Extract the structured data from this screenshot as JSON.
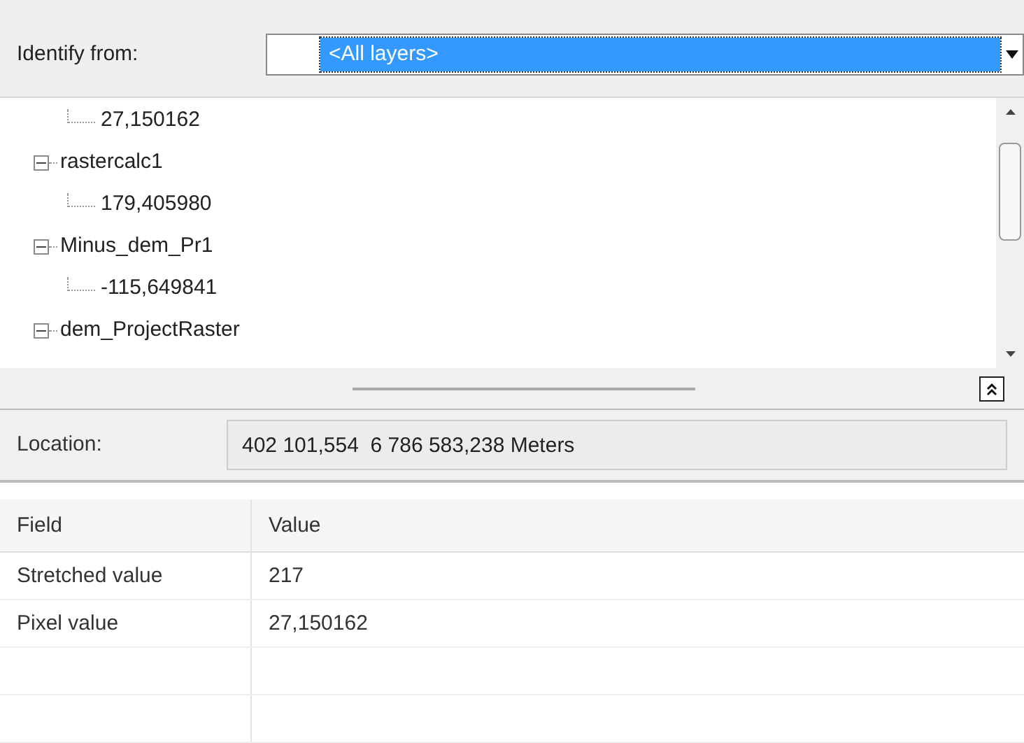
{
  "identify": {
    "label": "Identify from:",
    "value": "<All layers>"
  },
  "tree": [
    {
      "label": "27,150162",
      "kind": "leaf"
    },
    {
      "label": "rastercalc1",
      "kind": "node",
      "expanded": true,
      "children": [
        {
          "label": "179,405980",
          "kind": "leaf"
        }
      ]
    },
    {
      "label": "Minus_dem_Pr1",
      "kind": "node",
      "expanded": true,
      "children": [
        {
          "label": "-115,649841",
          "kind": "leaf"
        }
      ]
    },
    {
      "label": "dem_ProjectRaster",
      "kind": "node",
      "expanded": true
    }
  ],
  "location": {
    "label": "Location:",
    "value": "402 101,554  6 786 583,238 Meters"
  },
  "table": {
    "columns": [
      "Field",
      "Value"
    ],
    "rows": [
      [
        "Stretched value",
        "217"
      ],
      [
        "Pixel value",
        "27,150162"
      ]
    ]
  }
}
